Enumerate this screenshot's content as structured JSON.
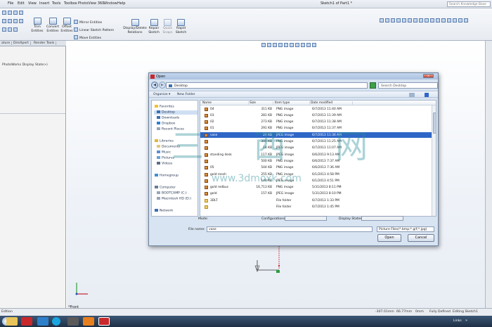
{
  "menubar": {
    "items": [
      "File",
      "Edit",
      "View",
      "Insert",
      "Tools",
      "Toolbox",
      "PhotoView 360",
      "Window",
      "Help"
    ],
    "doc_title": "Sketch1 of Part1 *",
    "search_placeholder": "Search Knowledge Base"
  },
  "ribbon": {
    "trim": "Trim Entities",
    "convert": "Convert Entities",
    "offset": "Offset Entities",
    "mirror": "Mirror Entities",
    "linear": "Linear Sketch Pattern",
    "move": "Move Entities",
    "display": "Display/Delete Relations",
    "repair": "Repair Sketch",
    "quick": "Quick Snaps",
    "rapid": "Rapid Sketch"
  },
  "cm_tabs": [
    "ature",
    "DimXpert",
    "Render Tools"
  ],
  "tree": {
    "line1": "PhotoWorks Display State>)"
  },
  "viewport": {
    "label": "*Front"
  },
  "status": {
    "left": "Edition",
    "x": "-307.01mm",
    "y": "66.77mm",
    "z": "0mm",
    "defined": "Fully Defined",
    "editing": "Editing Sketch1"
  },
  "taskbar": {
    "links": "Links",
    "clock": "»"
  },
  "dialog": {
    "title": "Open",
    "address": "Desktop",
    "search_placeholder": "Search Desktop",
    "organize": "Organize ▾",
    "new_folder": "New Folder",
    "nav": {
      "favorites": "Favorites",
      "desktop": "Desktop",
      "downloads": "Downloads",
      "dropbox": "Dropbox",
      "recent": "Recent Places",
      "libraries": "Libraries",
      "documents": "Documents",
      "music": "Music",
      "pictures": "Pictures",
      "videos": "Videos",
      "homegroup": "Homegroup",
      "computer": "Computer",
      "bootcamp": "BOOTCAMP (C:)",
      "machd": "Macintosh HD (D:)",
      "network": "Network"
    },
    "columns": {
      "name": "Name",
      "size": "Size",
      "type": "Item type",
      "date": "Date modified"
    },
    "files": [
      {
        "name": "04",
        "size": "311 KB",
        "type": "PNG image",
        "date": "6/7/2013 11:40 AM"
      },
      {
        "name": "03",
        "size": "281 KB",
        "type": "PNG image",
        "date": "6/7/2013 11:39 AM"
      },
      {
        "name": "02",
        "size": "273 KB",
        "type": "PNG image",
        "date": "6/7/2013 11:38 AM"
      },
      {
        "name": "01",
        "size": "291 KB",
        "type": "PNG image",
        "date": "6/7/2013 11:37 AM"
      },
      {
        "name": "vase",
        "size": "24 KB",
        "type": "JPEG image",
        "date": "6/7/2013 11:36 AM"
      },
      {
        "name": "",
        "size": "300 KB",
        "type": "PNG image",
        "date": "6/7/2013 11:25 AM"
      },
      {
        "name": "",
        "size": "18 KB",
        "type": "JPEG image",
        "date": "6/7/2013 11:07 AM"
      },
      {
        "name": "standing desk",
        "size": "117 KB",
        "type": "JPEG image",
        "date": "6/6/2013 9:13 AM"
      },
      {
        "name": "",
        "size": "500 KB",
        "type": "PNG image",
        "date": "6/6/2013 7:37 AM"
      },
      {
        "name": "05",
        "size": "544 KB",
        "type": "PNG image",
        "date": "6/6/2013 7:36 AM"
      },
      {
        "name": "gold mesh",
        "size": "255 KB",
        "type": "PNG image",
        "date": "6/1/2013 4:58 PM"
      },
      {
        "name": "",
        "size": "144 KB",
        "type": "JPEG image",
        "date": "6/1/2013 4:51 PM"
      },
      {
        "name": "gold redbus",
        "size": "16,713 KB",
        "type": "PNG image",
        "date": "5/31/2013 8:11 PM"
      },
      {
        "name": "gold",
        "size": "157 KB",
        "type": "JPEG image",
        "date": "5/31/2013 8:10 PM"
      },
      {
        "name": "3DLT",
        "size": "",
        "type": "File folder",
        "date": "6/7/2013 1:33 PM"
      },
      {
        "name": "",
        "size": "",
        "type": "File folder",
        "date": "6/7/2013 1:45 PM"
      }
    ],
    "mode_label": "Mode:",
    "configs_label": "Configurations:",
    "display_states_label": "Display States:",
    "filename_label": "File name:",
    "filename_value": "vase",
    "filter_value": "Picture Files(*.bmp;*.gif;*.jpg)",
    "open": "Open",
    "cancel": "Cancel"
  },
  "watermark": {
    "cn": "三 西 网",
    "url": "www.3dmoxk.com"
  }
}
